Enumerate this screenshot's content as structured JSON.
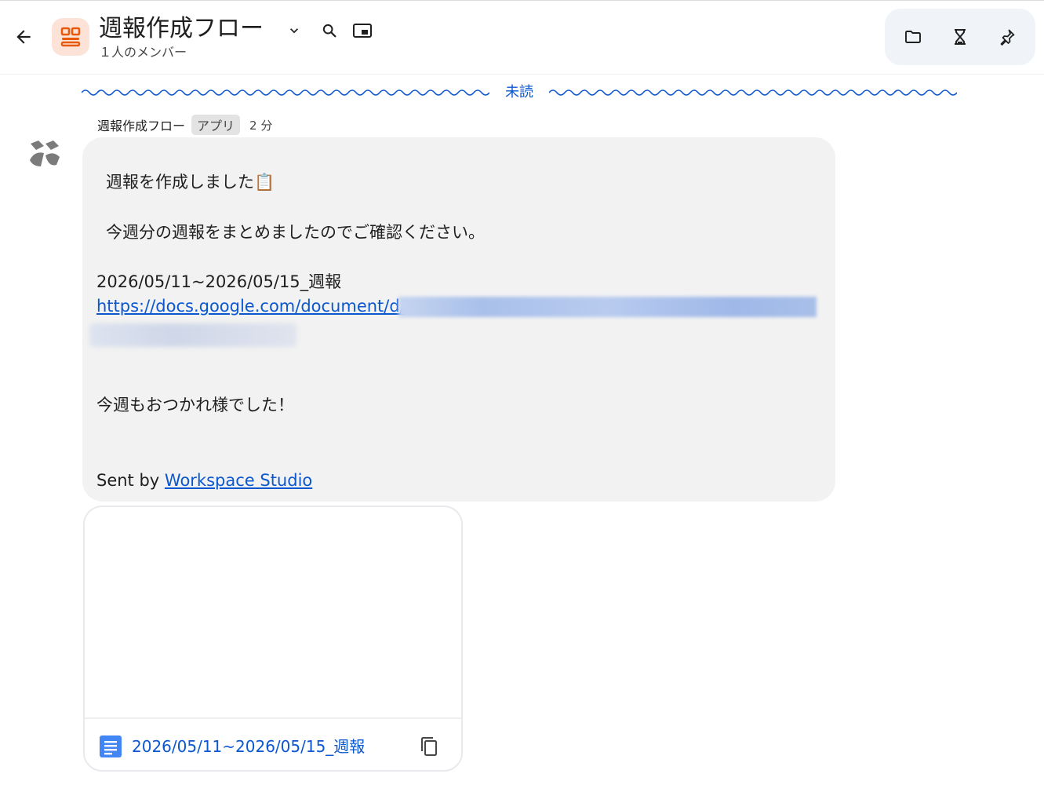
{
  "header": {
    "title": "週報作成フロー",
    "members": "１人のメンバー",
    "icons": {
      "back": "arrow-back-icon",
      "avatar": "space-avatar-icon",
      "dropdown": "chevron-down-icon",
      "search": "search-icon",
      "pip": "picture-in-picture-icon",
      "files": "folder-icon",
      "workflow": "hourglass-icon",
      "pin": "pin-icon"
    }
  },
  "divider": {
    "label": "未読"
  },
  "message": {
    "sender": "週報作成フロー",
    "badge": "アプリ",
    "time": "2 分",
    "line1": "週報を作成しました📋",
    "line2": "今週分の週報をまとめましたのでご確認ください。",
    "doc_name": "2026/05/11~2026/05/15_週報",
    "link_visible": "https://docs.google.com/document/d/",
    "closing": "今週もおつかれ様でした！",
    "sent_by_prefix": "Sent by ",
    "sent_by_link": "Workspace Studio"
  },
  "attachment": {
    "title": "2026/05/11~2026/05/15_週報",
    "icon": "google-docs-icon",
    "copy_icon": "copy-icon"
  },
  "colors": {
    "accent": "#0b57d0",
    "avatar_bg": "#fde3d7",
    "avatar_fg": "#e8590c",
    "bubble_bg": "#f2f2f2",
    "doc_blue": "#4285f4"
  }
}
